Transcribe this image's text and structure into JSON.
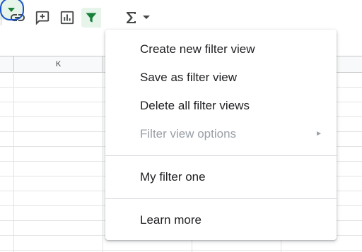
{
  "toolbar": {
    "icons": [
      "link-icon",
      "add-comment-icon",
      "insert-chart-icon",
      "filter-icon",
      "chevron-down-icon",
      "sigma-icon",
      "chevron-down-icon"
    ],
    "accent": "#188038",
    "focus_ring": "#1a52c8"
  },
  "sheet": {
    "column_label": "K"
  },
  "menu": {
    "items": [
      {
        "label": "Create new filter view",
        "enabled": true
      },
      {
        "label": "Save as filter view",
        "enabled": true
      },
      {
        "label": "Delete all filter views",
        "enabled": true
      },
      {
        "label": "Filter view options",
        "enabled": false,
        "submenu": true
      },
      {
        "label": "My filter one",
        "enabled": true
      },
      {
        "label": "Learn more",
        "enabled": true
      }
    ],
    "submenu_arrow": "►"
  }
}
